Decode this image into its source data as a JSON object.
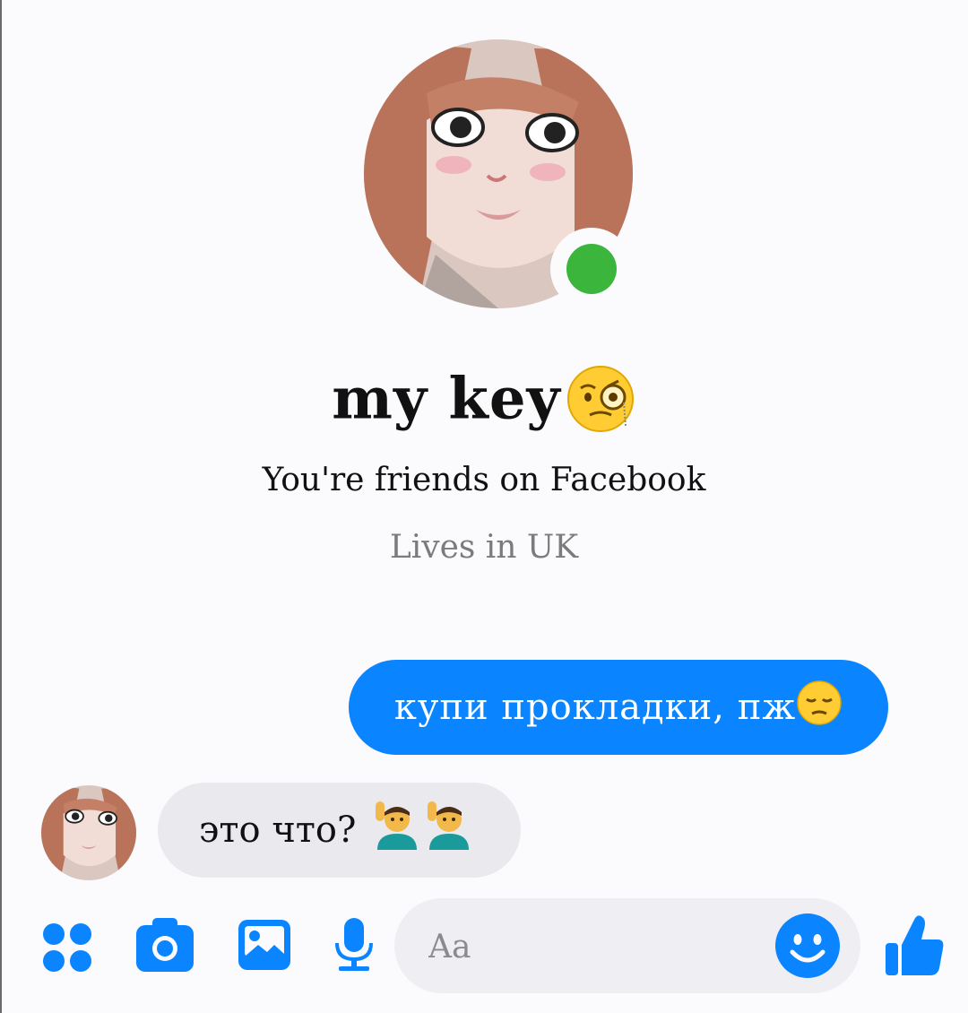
{
  "profile": {
    "name": "my key",
    "name_emoji": "face-with-monocle",
    "friends_text": "You're friends on Facebook",
    "location_text": "Lives in UK",
    "online": true,
    "online_color": "#3bb53b"
  },
  "messages": [
    {
      "direction": "outgoing",
      "text": "купи прокладки, пж",
      "emoji": "pensive-face"
    },
    {
      "direction": "incoming",
      "text": "это что?",
      "emoji": [
        "man-raising-hand",
        "man-raising-hand"
      ]
    }
  ],
  "composer": {
    "placeholder": "Aa",
    "icons": [
      "apps-icon",
      "camera-icon",
      "gallery-icon",
      "microphone-icon",
      "emoji-icon",
      "thumbs-up-icon"
    ]
  },
  "colors": {
    "accent": "#0a84ff",
    "incoming_bubble": "#e9e9ee",
    "input_bg": "#efeff3"
  }
}
